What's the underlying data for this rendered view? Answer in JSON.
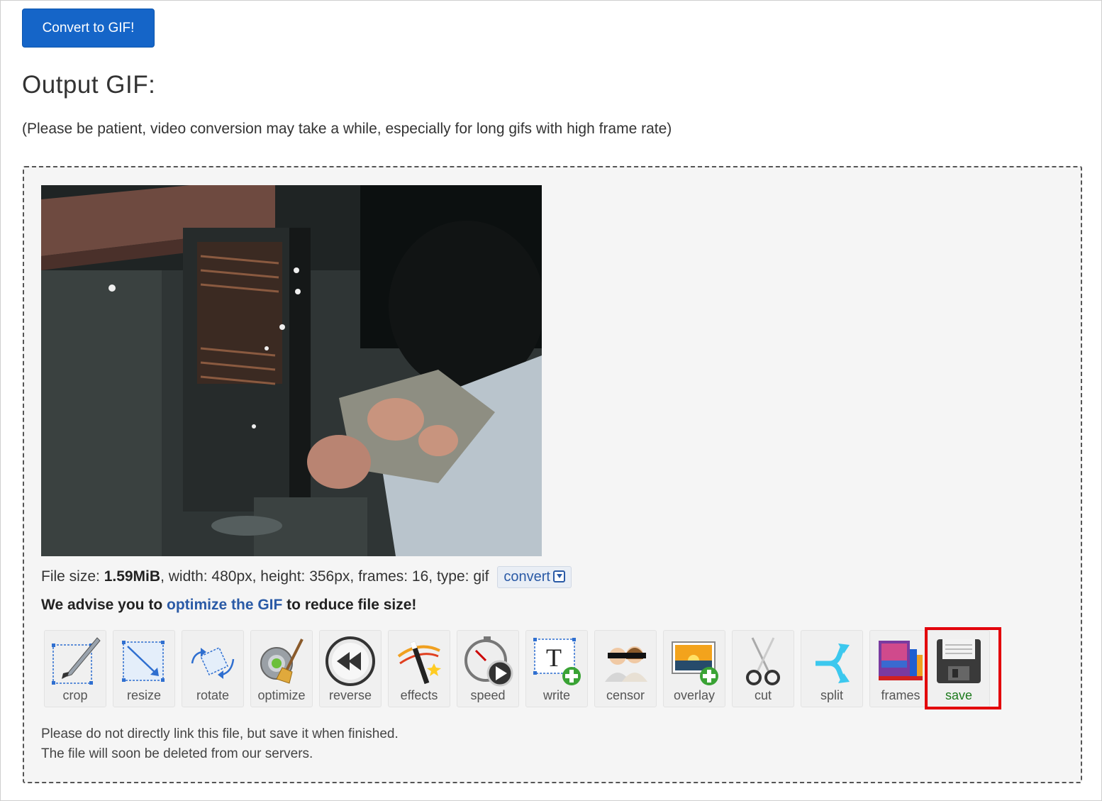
{
  "convert_button": "Convert to GIF!",
  "output_title": "Output GIF:",
  "patience_note": "(Please be patient, video conversion may take a while, especially for long gifs with high frame rate)",
  "file_info": {
    "prefix": "File size: ",
    "size": "1.59MiB",
    "rest": ", width: 480px, height: 356px, frames: 16, type: gif",
    "convert_label": "convert"
  },
  "advise": {
    "before": "We advise you to ",
    "link": "optimize the GIF",
    "after": " to reduce file size!"
  },
  "tools": [
    {
      "label": "crop",
      "icon": "crop-icon"
    },
    {
      "label": "resize",
      "icon": "resize-icon"
    },
    {
      "label": "rotate",
      "icon": "rotate-icon"
    },
    {
      "label": "optimize",
      "icon": "optimize-icon"
    },
    {
      "label": "reverse",
      "icon": "reverse-icon"
    },
    {
      "label": "effects",
      "icon": "effects-icon"
    },
    {
      "label": "speed",
      "icon": "speed-icon"
    },
    {
      "label": "write",
      "icon": "write-icon"
    },
    {
      "label": "censor",
      "icon": "censor-icon"
    },
    {
      "label": "overlay",
      "icon": "overlay-icon"
    },
    {
      "label": "cut",
      "icon": "cut-icon"
    },
    {
      "label": "split",
      "icon": "split-icon"
    },
    {
      "label": "frames",
      "icon": "frames-icon"
    },
    {
      "label": "save",
      "icon": "save-icon"
    }
  ],
  "footer": {
    "line1": "Please do not directly link this file, but save it when finished.",
    "line2": "The file will soon be deleted from our servers."
  },
  "colors": {
    "primary": "#1565c8",
    "link": "#2a5aa6",
    "highlight": "#e3000b"
  }
}
